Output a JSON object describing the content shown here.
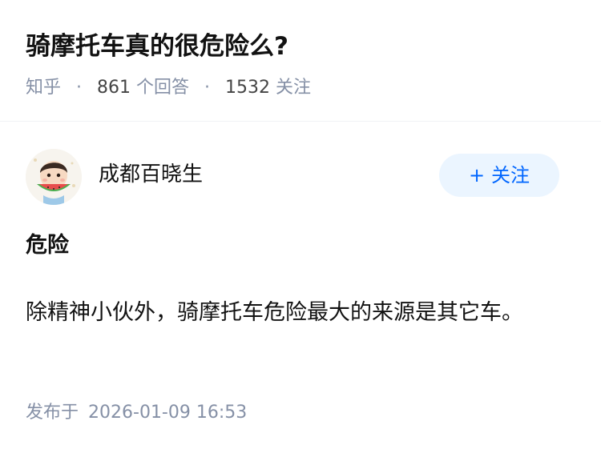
{
  "question": {
    "title": "骑摩托车真的很危险么?",
    "source": "知乎",
    "answer_count": "861",
    "answer_label": "个回答",
    "follow_count": "1532",
    "follow_label": "关注"
  },
  "author": {
    "name": "成都百晓生",
    "avatar_icon": "avatar-child-eating-watermelon",
    "follow_button": "关注"
  },
  "answer": {
    "heading": "危险",
    "body": "除精神小伙外，骑摩托车危险最大的来源是其它车。",
    "published_label": "发布于",
    "published_time": "2026-01-09 16:53"
  },
  "colors": {
    "accent": "#0066ff",
    "button_bg": "#ebf5ff",
    "meta_gray": "#8590a6",
    "text": "#121212"
  }
}
